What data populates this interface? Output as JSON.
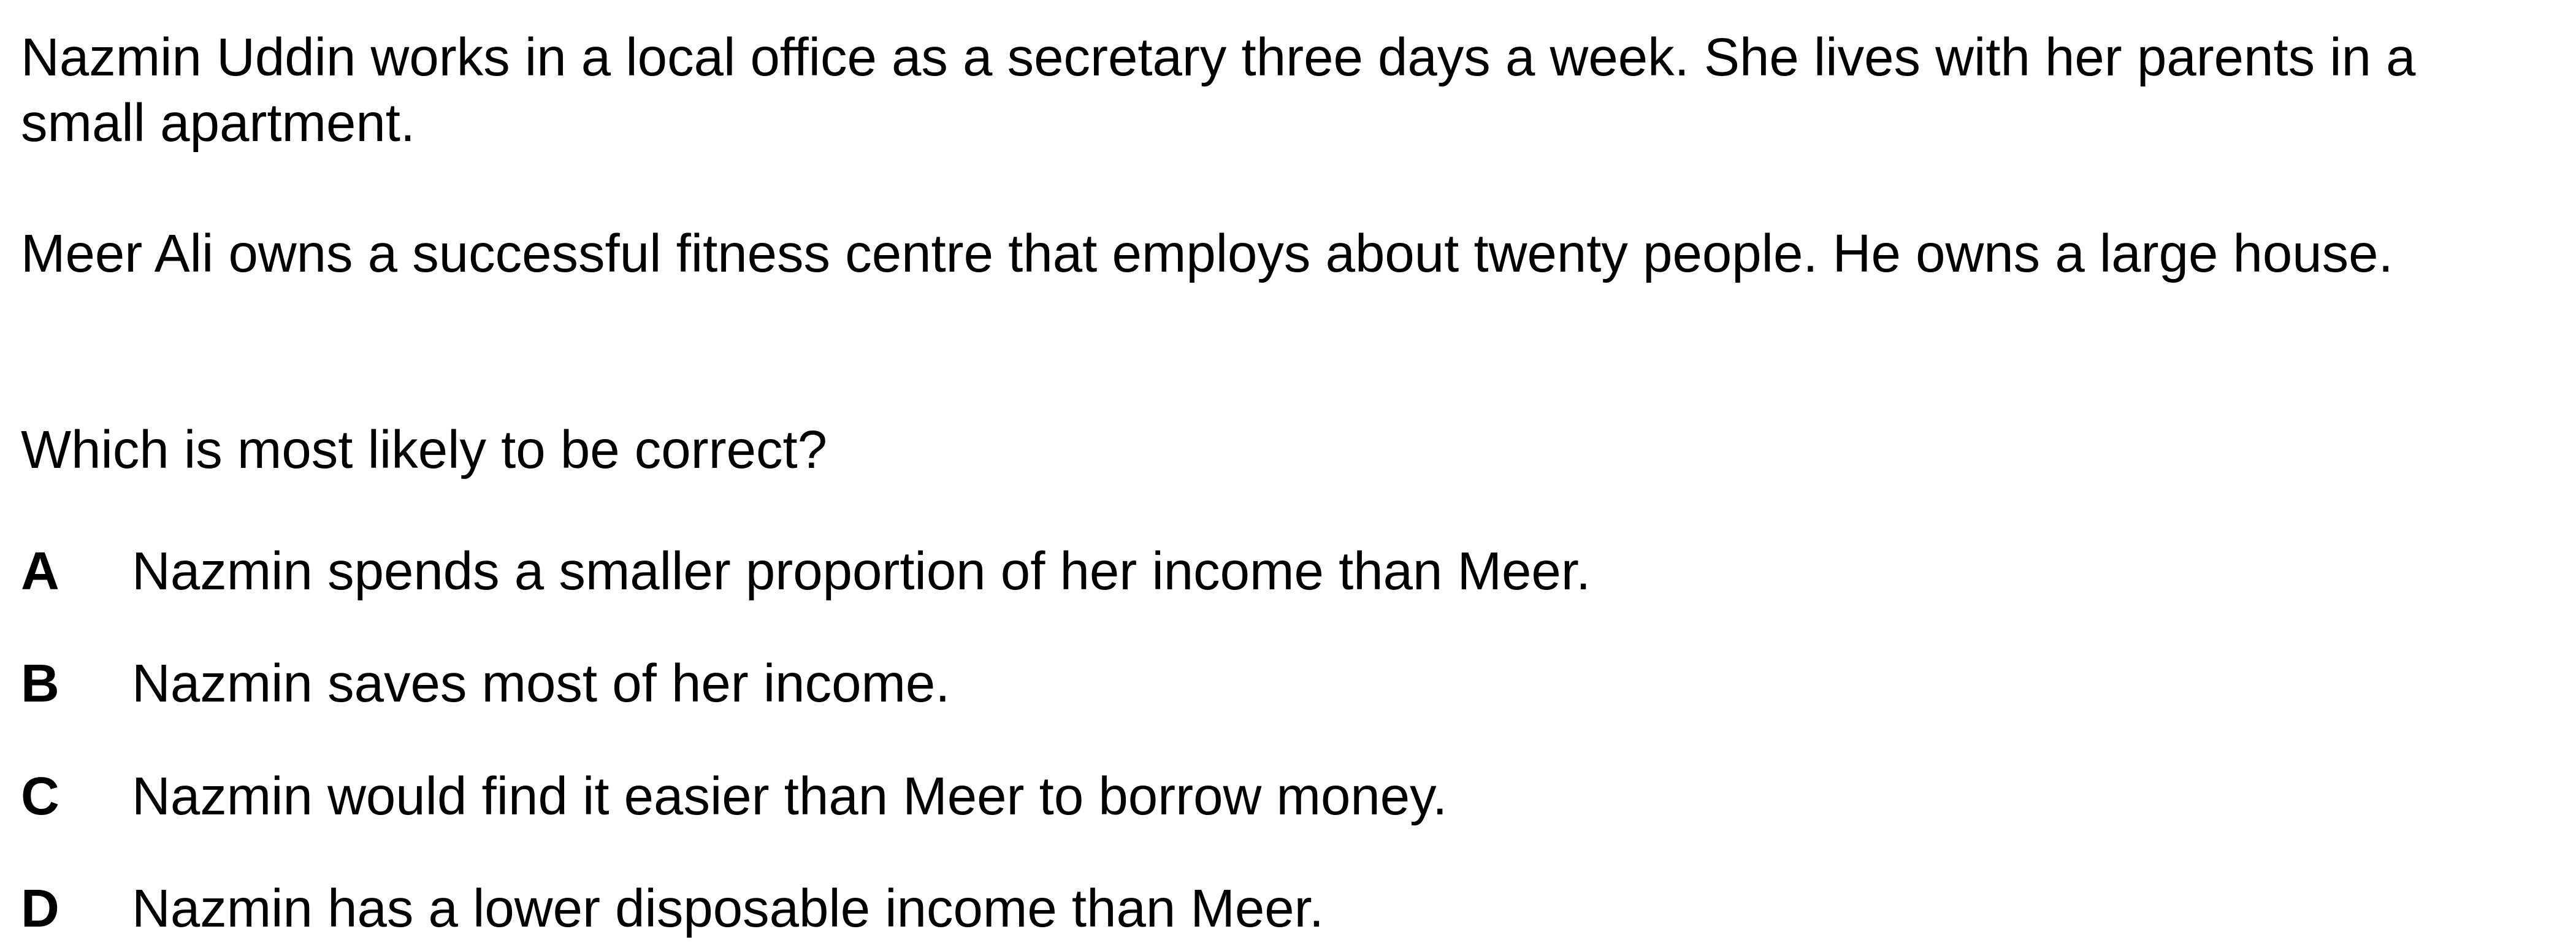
{
  "passage": {
    "paragraph_1": "Nazmin Uddin works in a local office as a secretary three days a week. She lives with her parents in a small apartment.",
    "paragraph_2": "Meer Ali owns a successful fitness centre that employs about twenty people. He owns a large house."
  },
  "question": "Which is most likely to be correct?",
  "options": [
    {
      "letter": "A",
      "text": "Nazmin spends a smaller proportion of her income than Meer."
    },
    {
      "letter": "B",
      "text": "Nazmin saves most of her income."
    },
    {
      "letter": "C",
      "text": "Nazmin would find it easier than Meer to borrow money."
    },
    {
      "letter": "D",
      "text": "Nazmin has a lower disposable income than Meer."
    }
  ]
}
